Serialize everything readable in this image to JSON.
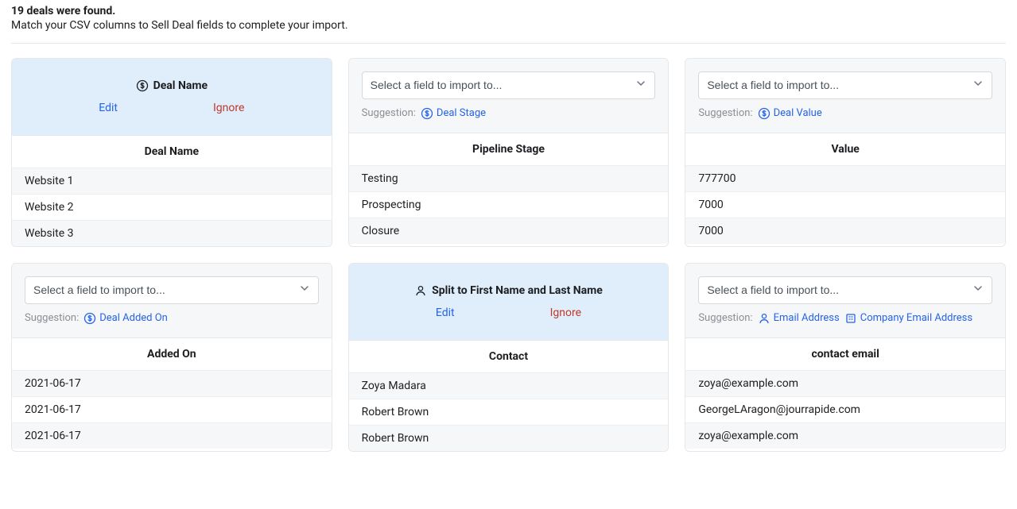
{
  "header": {
    "title": "19 deals were found.",
    "subtitle": "Match your CSV columns to Sell Deal fields to complete your import."
  },
  "select_placeholder": "Select a field to import to...",
  "suggestion_label": "Suggestion:",
  "actions": {
    "edit": "Edit",
    "ignore": "Ignore"
  },
  "cards": [
    {
      "mapped": true,
      "mapped_icon": "dollar",
      "mapped_label": "Deal Name",
      "column_header": "Deal Name",
      "rows": [
        "Website 1",
        "Website 2",
        "Website 3"
      ]
    },
    {
      "mapped": false,
      "suggestions": [
        {
          "icon": "dollar",
          "label": "Deal Stage"
        }
      ],
      "column_header": "Pipeline Stage",
      "rows": [
        "Testing",
        "Prospecting",
        "Closure"
      ]
    },
    {
      "mapped": false,
      "suggestions": [
        {
          "icon": "dollar",
          "label": "Deal Value"
        }
      ],
      "column_header": "Value",
      "rows": [
        "777700",
        "7000",
        "7000"
      ]
    },
    {
      "mapped": false,
      "suggestions": [
        {
          "icon": "dollar",
          "label": "Deal Added On"
        }
      ],
      "column_header": "Added On",
      "rows": [
        "2021-06-17",
        "2021-06-17",
        "2021-06-17"
      ]
    },
    {
      "mapped": true,
      "mapped_icon": "person",
      "mapped_label": "Split to First Name and Last Name",
      "column_header": "Contact",
      "rows": [
        "Zoya Madara",
        "Robert Brown",
        "Robert Brown"
      ]
    },
    {
      "mapped": false,
      "suggestions": [
        {
          "icon": "person",
          "label": "Email Address"
        },
        {
          "icon": "company",
          "label": "Company Email Address"
        }
      ],
      "column_header": "contact email",
      "rows": [
        "zoya@example.com",
        "GeorgeLAragon@jourrapide.com",
        "zoya@example.com"
      ]
    }
  ]
}
